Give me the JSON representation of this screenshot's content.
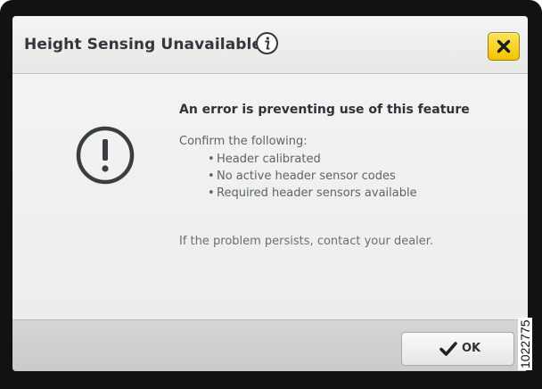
{
  "dialog": {
    "title": "Height Sensing Unavailable",
    "icons": {
      "info": "info-icon",
      "close": "close-icon",
      "warning": "exclamation-circle-icon",
      "ok": "checkmark-icon"
    },
    "close_button_color": "#F3C300",
    "heading": "An error is preventing use of this feature",
    "intro": "Confirm the following:",
    "checklist": [
      "Header calibrated",
      "No active header sensor codes",
      "Required header sensors available"
    ],
    "note": "If the problem persists, contact your dealer.",
    "ok_label": "OK"
  },
  "figure_reference": "1022775"
}
